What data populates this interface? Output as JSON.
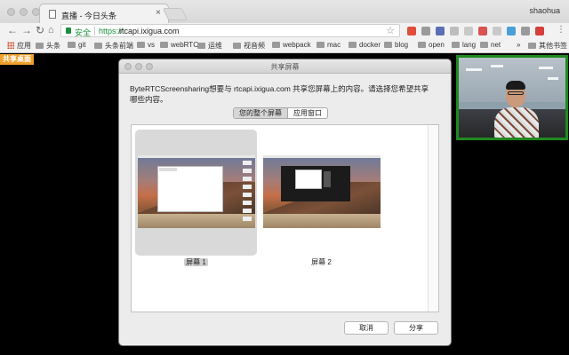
{
  "browser": {
    "tab_title": "直播 - 今日头条",
    "tab_close": "×",
    "user_name": "shaohua",
    "omnibox": {
      "secure_label": "安全",
      "scheme": "https://",
      "host": "rtcapi.ixigua.com"
    },
    "bookmarks": [
      {
        "label": "应用",
        "kind": "apps"
      },
      {
        "label": "头条"
      },
      {
        "label": "git"
      },
      {
        "label": "头条前端"
      },
      {
        "label": "vs"
      },
      {
        "label": "webRTC"
      },
      {
        "label": "运维"
      },
      {
        "label": "视音频"
      },
      {
        "label": "webpack"
      },
      {
        "label": "mac"
      },
      {
        "label": "docker"
      },
      {
        "label": "blog"
      },
      {
        "label": "open"
      },
      {
        "label": "lang"
      },
      {
        "label": "net"
      }
    ],
    "bookmarks_overflow": "»",
    "other_bookmarks": "其他书签",
    "extension_colors": [
      "#e04f3a",
      "#9a9a9a",
      "#5a6fb5",
      "#bdbdbd",
      "#c9c9c9",
      "#d9534f",
      "#c9c9c9",
      "#4a9fd8",
      "#9a9a9a",
      "#d43f3a"
    ]
  },
  "page": {
    "share_badge": "共享桌面"
  },
  "dialog": {
    "title": "共享屏幕",
    "prompt": "ByteRTCScreensharing想要与 rtcapi.ixigua.com 共享您屏幕上的内容。请选择您希望共享哪些内容。",
    "tabs": [
      {
        "label": "您的整个屏幕",
        "active": true
      },
      {
        "label": "应用窗口",
        "active": false
      }
    ],
    "screens": [
      {
        "label": "屏幕 1",
        "selected": true
      },
      {
        "label": "屏幕 2",
        "selected": false
      }
    ],
    "cancel_label": "取消",
    "share_label": "分享"
  },
  "colors": {
    "accent_orange": "#f0a02d",
    "camera_border": "#1f8a1f",
    "secure_green": "#1e8e3e"
  }
}
